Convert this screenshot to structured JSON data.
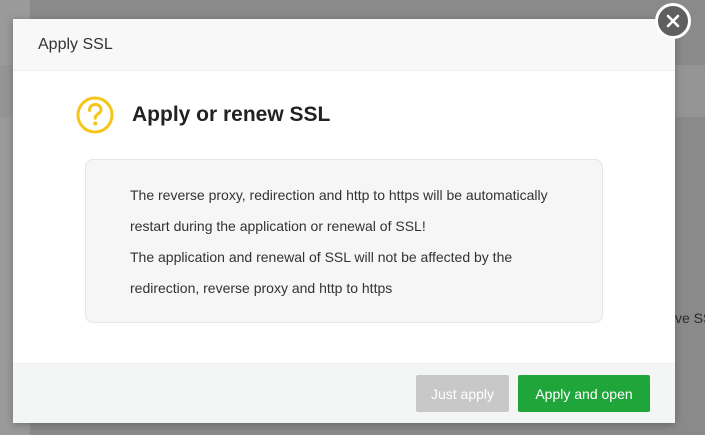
{
  "background": {
    "partial_text": "ve SS"
  },
  "dialog": {
    "title": "Apply SSL",
    "heading": "Apply or renew SSL",
    "info_lines": [
      "The reverse proxy, redirection and http to https will be automatically",
      "restart during the application or renewal of SSL!",
      "The application and renewal of SSL will not be affected by the",
      "redirection, reverse proxy and http to https"
    ],
    "buttons": {
      "just_apply": "Just apply",
      "apply_and_open": "Apply and open"
    }
  },
  "colors": {
    "accent_green": "#20a53a",
    "icon_yellow": "#f5c518",
    "disabled_gray": "#c8c8c8",
    "close_button": "#5f5f5f"
  },
  "icons": {
    "close": "close-icon",
    "question": "question-icon"
  }
}
